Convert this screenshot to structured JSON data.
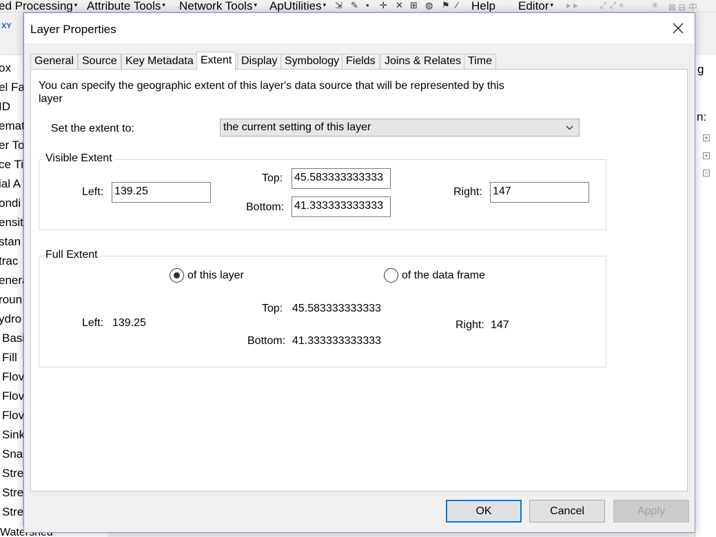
{
  "app": {
    "menu": [
      {
        "label": "ed Processing",
        "caret": "▾"
      },
      {
        "label": "Attribute Tools",
        "caret": "▾"
      },
      {
        "label": "Network Tools",
        "caret": "▾"
      },
      {
        "label": "ApUtilities",
        "caret": "▾"
      },
      {
        "label": "Help",
        "caret": ""
      },
      {
        "label": "Editor",
        "caret": "▾"
      }
    ],
    "toc_items": [
      "ox",
      "el Fa",
      "ID",
      "emat",
      "er To",
      "ce Ti",
      "ial A",
      "ondi",
      "ensit",
      "stan",
      "trac",
      "enera",
      "roun",
      "ydro",
      "Basi",
      "Fill",
      "Flov",
      "Flov",
      "Flov",
      "Sink",
      "Sna",
      "Stre",
      "Stre",
      "Stre"
    ],
    "bottom_fragment": "Watershed",
    "right_panel": {
      "header": "g",
      "label": "n:"
    }
  },
  "dialog": {
    "title": "Layer Properties",
    "close_icon": "close-icon",
    "tabs": [
      {
        "label": "General",
        "active": false
      },
      {
        "label": "Source",
        "active": false
      },
      {
        "label": "Key Metadata",
        "active": false
      },
      {
        "label": "Extent",
        "active": true
      },
      {
        "label": "Display",
        "active": false
      },
      {
        "label": "Symbology",
        "active": false
      },
      {
        "label": "Fields",
        "active": false
      },
      {
        "label": "Joins & Relates",
        "active": false
      },
      {
        "label": "Time",
        "active": false
      }
    ],
    "extent_tab": {
      "intro": "You can specify the geographic extent of this layer's data source that will be represented by this layer",
      "set_extent_label": "Set the extent to:",
      "set_extent_value": "the current setting of this layer",
      "visible_extent": {
        "title": "Visible Extent",
        "left_label": "Left:",
        "left_value": "139.25",
        "top_label": "Top:",
        "top_value": "45.583333333333",
        "bottom_label": "Bottom:",
        "bottom_value": "41.333333333333",
        "right_label": "Right:",
        "right_value": "147"
      },
      "full_extent": {
        "title": "Full Extent",
        "option_layer": "of this layer",
        "option_frame": "of the data frame",
        "selected": "layer",
        "left_label": "Left:",
        "left_value": "139.25",
        "top_label": "Top:",
        "top_value": "45.583333333333",
        "bottom_label": "Bottom:",
        "bottom_value": "41.333333333333",
        "right_label": "Right:",
        "right_value": "147"
      }
    },
    "buttons": {
      "ok": "OK",
      "cancel": "Cancel",
      "apply": "Apply"
    }
  }
}
